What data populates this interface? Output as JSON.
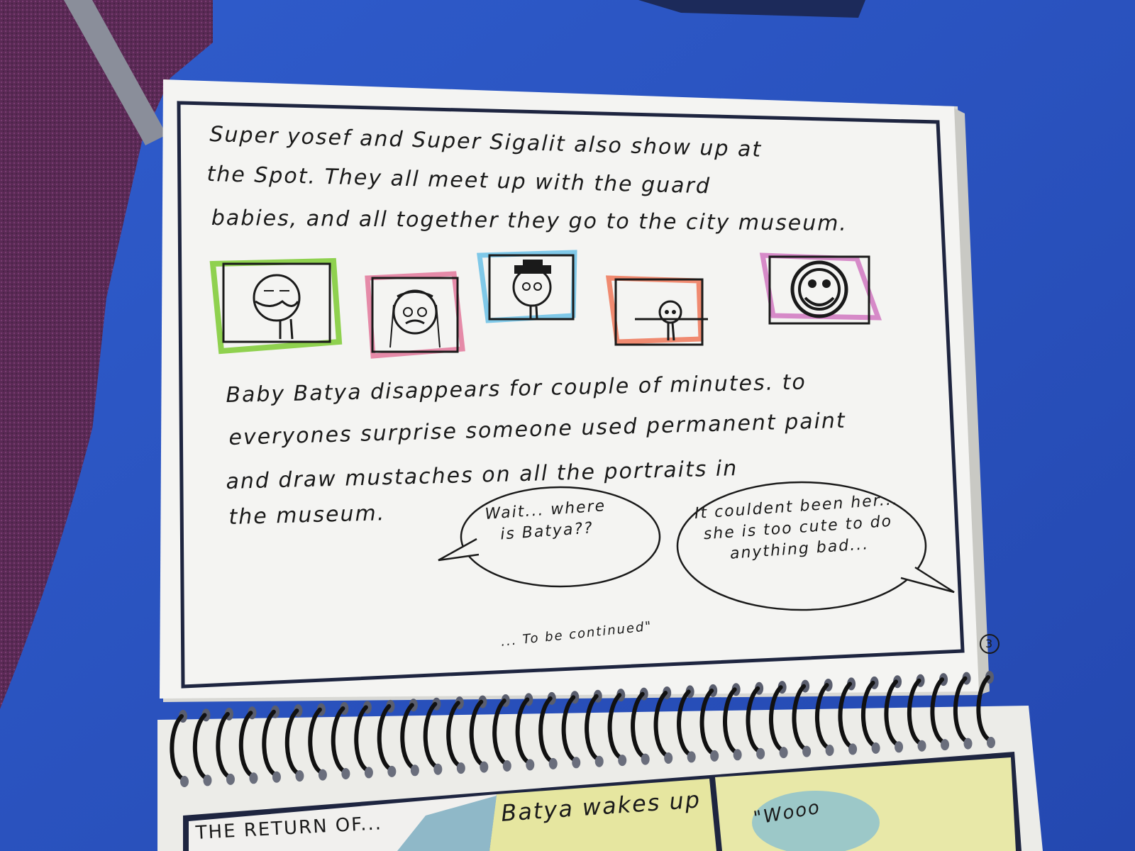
{
  "page": {
    "panel_text": {
      "paragraph_1": [
        "Super yosef and Super Sigalit also show up at",
        "the Spot.  They all meet up with the guard",
        "babies, and all together they go to the city museum."
      ],
      "paragraph_2": [
        "Baby Batya disappears for couple of minutes.  to",
        "everyones surprise someone used permanent paint",
        "and draw mustaches on all the portraits in",
        "the museum."
      ]
    },
    "speech_bubbles": [
      {
        "text": "Wait... where is Batya??"
      },
      {
        "text": "It couldent been her... she is too cute to do anything bad..."
      }
    ],
    "continued_note": "... To be continued\"",
    "page_number": "3",
    "portrait_frame_colors": [
      "#8fd14f",
      "#e58aa8",
      "#7fc8e8",
      "#f08a70",
      "#d68ac8"
    ]
  },
  "next_page": {
    "title_fragment": "THE RETURN OF...",
    "caption": "Batya wakes up",
    "bubble": "\"Wooo"
  },
  "colors": {
    "table": "#2d55c2",
    "carpet": "#5a2a55",
    "paper": "#f4f4f2",
    "ink": "#1a1a1a",
    "comic_bg": "#e8e6a8"
  }
}
